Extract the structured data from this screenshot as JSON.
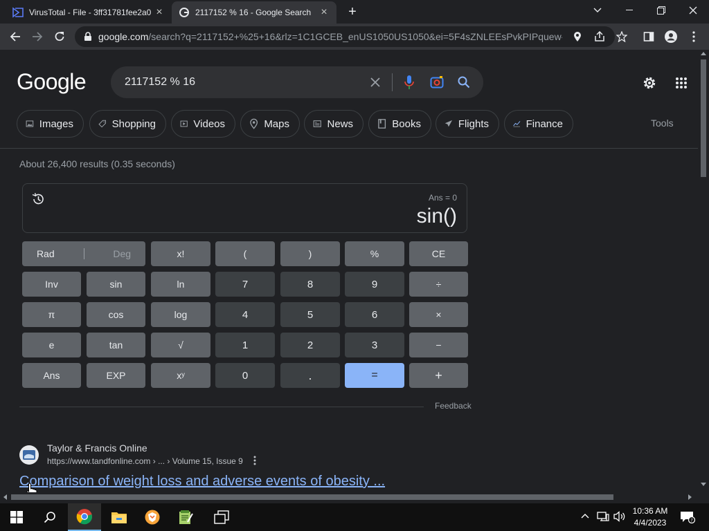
{
  "browser": {
    "tabs": [
      {
        "title": "VirusTotal - File - 3ff31781fee2a0",
        "active": false
      },
      {
        "title": "2117152 % 16 - Google Search",
        "active": true
      }
    ],
    "url_host": "google.com",
    "url_rest": "/search?q=2117152+%25+16&rlz=1C1GCEB_enUS1050US1050&ei=5F4sZNLEEsPvkPIPquew-A..."
  },
  "google": {
    "logo": "Google",
    "query": "2117152 % 16",
    "chips": [
      "Images",
      "Shopping",
      "Videos",
      "Maps",
      "News",
      "Books",
      "Flights",
      "Finance"
    ],
    "tools": "Tools",
    "result_stats": "About 26,400 results (0.35 seconds)"
  },
  "calculator": {
    "ans": "Ans = 0",
    "expression": "sin()",
    "rad": "Rad",
    "deg": "Deg",
    "keys": [
      [
        "x!",
        "(",
        ")",
        "%",
        "CE"
      ],
      [
        "Inv",
        "sin",
        "ln",
        "7",
        "8",
        "9",
        "÷"
      ],
      [
        "π",
        "cos",
        "log",
        "4",
        "5",
        "6",
        "×"
      ],
      [
        "e",
        "tan",
        "√",
        "1",
        "2",
        "3",
        "−"
      ],
      [
        "Ans",
        "EXP",
        "xʸ",
        "0",
        ".",
        "=",
        "+"
      ]
    ],
    "feedback": "Feedback"
  },
  "result": {
    "site": "Taylor & Francis Online",
    "url": "https://www.tandfonline.com › ... › Volume 15, Issue 9",
    "title": "Comparison of weight loss and adverse events of obesity ..."
  },
  "taskbar": {
    "time": "10:36 AM",
    "date": "4/4/2023"
  },
  "colors": {
    "page_bg": "#202124",
    "accent_blue": "#8ab4f8",
    "key_gray": "#5f6368",
    "key_num": "#3c4043"
  }
}
